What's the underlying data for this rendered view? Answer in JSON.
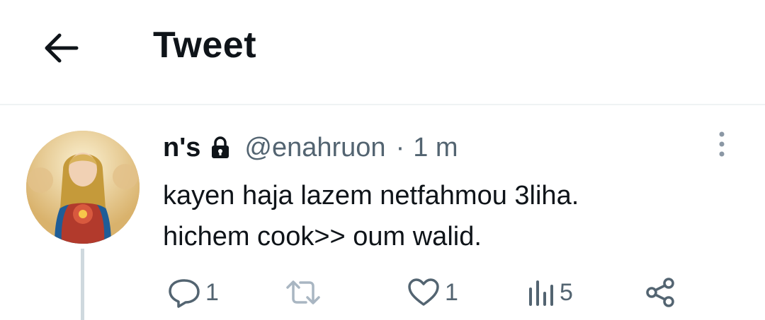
{
  "header": {
    "back_icon": "arrow-left-icon",
    "title": "Tweet"
  },
  "tweet": {
    "author_name": "n's",
    "locked_icon": "lock-icon",
    "handle": "@enahruon",
    "separator": "·",
    "time": "1 m",
    "text_lines": [
      "kayen haja lazem netfahmou 3liha.",
      "hichem cook>> oum walid."
    ],
    "more_icon": "more-vertical-icon"
  },
  "actions": {
    "reply_count": "1",
    "retweet_count": "",
    "like_count": "1",
    "views_count": "5"
  },
  "colors": {
    "text_primary": "#0f1419",
    "text_secondary": "#536471",
    "divider": "#eff3f4",
    "thread_line": "#cfd9de"
  }
}
